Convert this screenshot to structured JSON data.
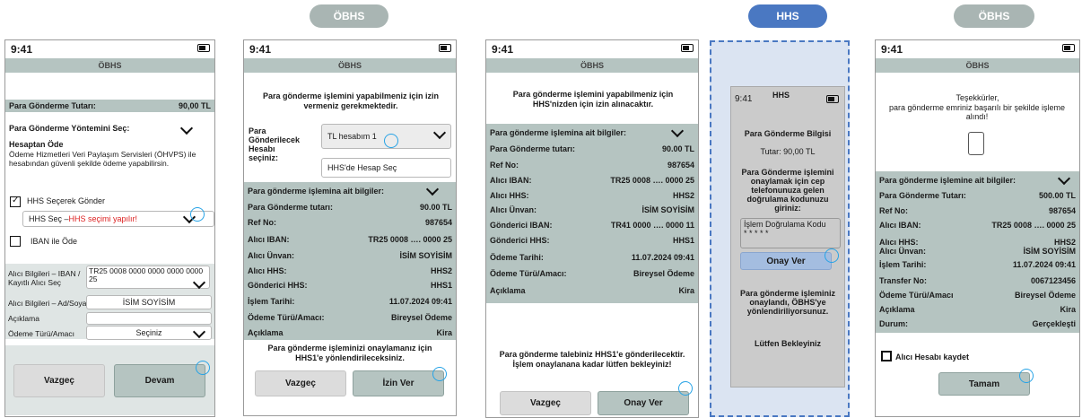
{
  "pills": [
    "ÖBHS",
    "HHS",
    "ÖBHS"
  ],
  "time": "9:41",
  "header": "ÖBHS",
  "s1": {
    "amount_label": "Para Gönderme Tutarı:",
    "amount_value": "90,00 TL",
    "method_label": "Para Gönderme Yöntemini Seç:",
    "from_account": "Hesaptan Öde",
    "desc": "Ödeme Hizmetleri Veri Paylaşım Servisleri (ÖHVPS) ile hesabından güvenli şekilde ödeme yapabilirsin.",
    "hhs_option": "HHS Seçerek Gönder",
    "hhs_select_prefix": "HHS Seç – ",
    "hhs_select_error": "HHS seçimi yapılır!",
    "iban_option": "IBAN ile Öde",
    "rec_label": "Alıcı Bilgileri – IBAN / Kayıtlı Alıcı Seç",
    "rec_iban": "TR25 0008 0000 0000 0000 0000 25",
    "rec_name_label": "Alıcı Bilgileri – Ad/Soyad",
    "rec_name_value": "İSİM SOYİSİM",
    "desc_label": "Açıklama",
    "purpose_label": "Ödeme Türü/Amacı",
    "purpose_value": "Seçiniz",
    "cancel": "Vazgeç",
    "continue": "Devam"
  },
  "s2": {
    "permission": "Para gönderme işlemini yapabilmeniz için izin vermeniz gerekmektedir.",
    "account_label": "Para Gönderilecek Hesabı seçiniz:",
    "account_value": "TL hesabım 1",
    "hhs_option": "HHS'de Hesap Seç",
    "info_title": "Para gönderme işlemina ait bilgiler:",
    "rows": [
      [
        "Para Gönderme tutarı:",
        "90.00 TL"
      ],
      [
        "Ref No:",
        "987654"
      ],
      [
        "Alıcı IBAN:",
        "TR25 0008 …. 0000 25"
      ],
      [
        "Alıcı Ünvan:",
        "İSİM SOYİSİM"
      ],
      [
        "Alıcı HHS:",
        "HHS2"
      ],
      [
        "Gönderici HHS:",
        "HHS1"
      ],
      [
        "İşlem Tarihi:",
        "11.07.2024 09:41"
      ],
      [
        "Ödeme Türü/Amacı:",
        "Bireysel Ödeme"
      ],
      [
        "Açıklama",
        "Kira"
      ]
    ],
    "footer": "Para gönderme işleminizi onaylamanız için HHS1'e yönlendirileceksiniz.",
    "cancel": "Vazgeç",
    "allow": "İzin Ver"
  },
  "s3": {
    "permission": "Para gönderme işlemini yapabilmeniz için HHS'nizden için izin alınacaktır.",
    "info_title": "Para gönderme işlemina ait bilgiler:",
    "rows": [
      [
        "Para Gönderme tutarı:",
        "90.00 TL"
      ],
      [
        "Ref No:",
        "987654"
      ],
      [
        "Alıcı IBAN:",
        "TR25 0008 …. 0000 25"
      ],
      [
        "Alıcı HHS:",
        "HHS2"
      ],
      [
        "Alıcı Ünvan:",
        "İSİM SOYİSİM"
      ],
      [
        "Gönderici IBAN:",
        "TR41 0000 …. 0000 11"
      ],
      [
        "Gönderici HHS:",
        "HHS1"
      ],
      [
        "Ödeme Tarihi:",
        "11.07.2024 09:41"
      ],
      [
        "Ödeme Türü/Amacı:",
        "Bireysel Ödeme"
      ],
      [
        "Açıklama",
        "Kira"
      ]
    ],
    "footer": "Para gönderme talebiniz HHS1'e gönderilecektir. İşlem onaylanana kadar lütfen bekleyiniz!",
    "cancel": "Vazgeç",
    "confirm": "Onay Ver"
  },
  "s4": {
    "title": "HHS",
    "info": "Para Gönderme Bilgisi",
    "amount": "Tutar: 90,00 TL",
    "sms": "Para Gönderme işlemini onaylamak için cep telefonunuza gelen doğrulama kodunuzu giriniz:",
    "code_label": "İşlem Doğrulama Kodu",
    "code_value": "* * * * *",
    "confirm": "Onay Ver",
    "approved": "Para gönderme işleminiz onaylandı, ÖBHS'ye yönlendiriliyorsunuz.",
    "wait": "Lütfen Bekleyiniz"
  },
  "s5": {
    "thanks": "Teşekkürler,",
    "msg": "para gönderme emriniz başarılı bir şekilde işleme alındı!",
    "info_title": "Para gönderme işlemine ait bilgiler:",
    "rows": [
      [
        "Para Gönderme Tutarı:",
        "500.00 TL"
      ],
      [
        "Ref No:",
        "987654"
      ],
      [
        "Alıcı IBAN:",
        "TR25 0008 …. 0000 25"
      ],
      [
        "Alıcı HHS:",
        "HHS2"
      ],
      [
        "Alıcı Ünvan:",
        "İSİM SOYİSİM"
      ],
      [
        "İşlem Tarihi:",
        "11.07.2024 09:41"
      ],
      [
        "Transfer No:",
        "0067123456"
      ],
      [
        "Ödeme Türü/Amacı",
        "Bireysel Ödeme"
      ],
      [
        "Açıklama",
        "Kira"
      ],
      [
        "Durum:",
        "Gerçekleşti"
      ]
    ],
    "save": "Alıcı Hesabı kaydet",
    "ok": "Tamam"
  }
}
